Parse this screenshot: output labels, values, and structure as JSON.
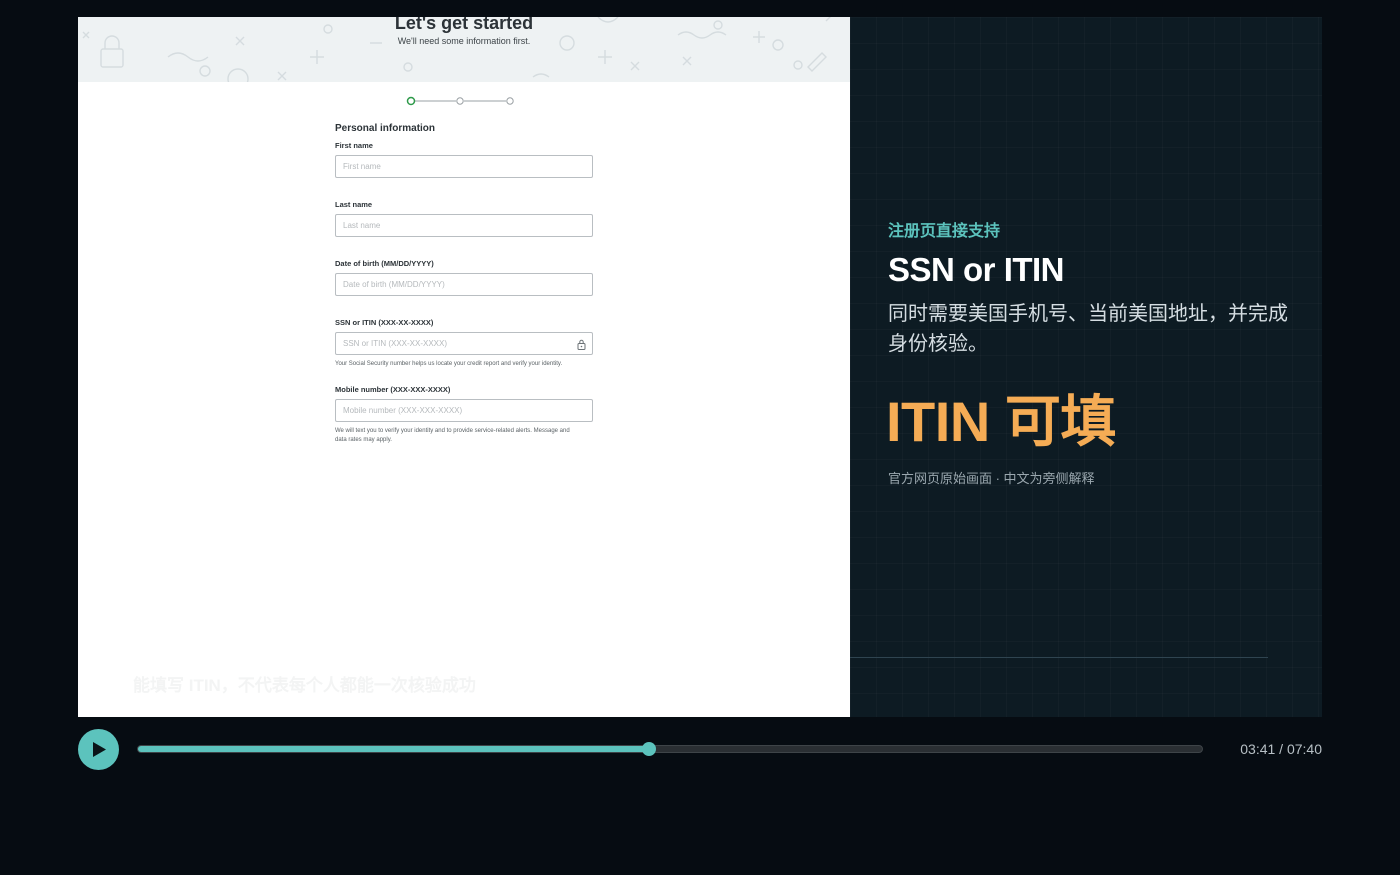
{
  "web_page": {
    "title": "Let's get started",
    "subtitle": "We'll need some information first.",
    "stepper": {
      "steps": 3,
      "current": 1
    },
    "section_title": "Personal information",
    "fields": {
      "first_name": {
        "label": "First name",
        "placeholder": "First name"
      },
      "last_name": {
        "label": "Last name",
        "placeholder": "Last name"
      },
      "dob": {
        "label": "Date of birth (MM/DD/YYYY)",
        "placeholder": "Date of birth (MM/DD/YYYY)"
      },
      "ssn": {
        "label": "SSN or ITIN (XXX-XX-XXXX)",
        "placeholder": "SSN or ITIN (XXX-XX-XXXX)",
        "help": "Your Social Security number helps us locate your credit report and verify your identity."
      },
      "mobile": {
        "label": "Mobile number (XXX-XXX-XXXX)",
        "placeholder": "Mobile number (XXX-XXX-XXXX)",
        "help": "We will text you to verify your identity and to provide service-related alerts. Message and data rates may apply."
      }
    },
    "caption_watermark": "能填写 ITIN，不代表每个人都能一次核验成功"
  },
  "panel": {
    "kicker": "注册页直接支持",
    "headline": "SSN or ITIN",
    "description": "同时需要美国手机号、当前美国地址，并完成身份核验。",
    "emphasis": "ITIN 可填",
    "note": "官方网页原始画面 · 中文为旁侧解释"
  },
  "player": {
    "progress_fraction": 0.4804,
    "time_display": "03:41 / 07:40"
  },
  "colors": {
    "accent": "#5cc3bd",
    "highlight": "#f5ac55",
    "panel_bg": "#0d1b23",
    "stepper_active": "#2e9a4a"
  }
}
